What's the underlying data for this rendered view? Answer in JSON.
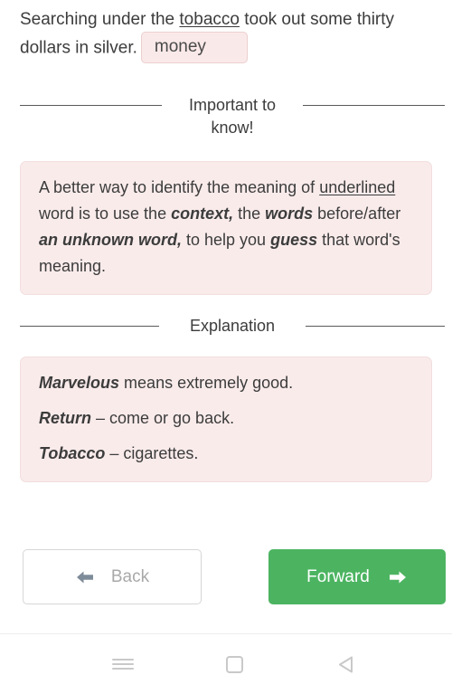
{
  "question": {
    "text_before_underline": "Searching under the ",
    "underlined_word": "tobacco",
    "text_after_underline": " took out some thirty dollars in silver.",
    "answer_value": "money",
    "answer_placeholder": "money"
  },
  "dividers": {
    "important": "Important to know!",
    "explanation": "Explanation"
  },
  "info_box": {
    "part1": "A better way to identify the meaning of ",
    "underlined": "underlined",
    "part2": " word is to use the ",
    "bold1": "context,",
    "part3": " the ",
    "bold2": "words",
    "part4": " before/after ",
    "bold3": "an unknown word,",
    "part5": " to help you ",
    "bold4": "guess",
    "part6": " that word's meaning."
  },
  "explanation_box": {
    "lines": [
      {
        "term": "Marvelous",
        "definition": " means extremely good."
      },
      {
        "term": "Return",
        "definition": " – come or go back."
      },
      {
        "term": "Tobacco",
        "definition": " – cigarettes."
      }
    ]
  },
  "buttons": {
    "back_label": "Back",
    "forward_label": "Forward",
    "back_icon": "arrow-left-icon",
    "forward_icon": "arrow-right-icon"
  },
  "system_nav": {
    "recents_icon": "hamburger-menu-icon",
    "home_icon": "home-square-icon",
    "back_icon": "triangle-back-icon"
  },
  "colors": {
    "forward_button": "#4cb461",
    "pink_box_bg": "#faebeb",
    "pink_box_border": "#f2dede",
    "text": "#3c3c3c",
    "back_arrow": "#7e8b99",
    "nav_icon": "#c9c9c9"
  }
}
